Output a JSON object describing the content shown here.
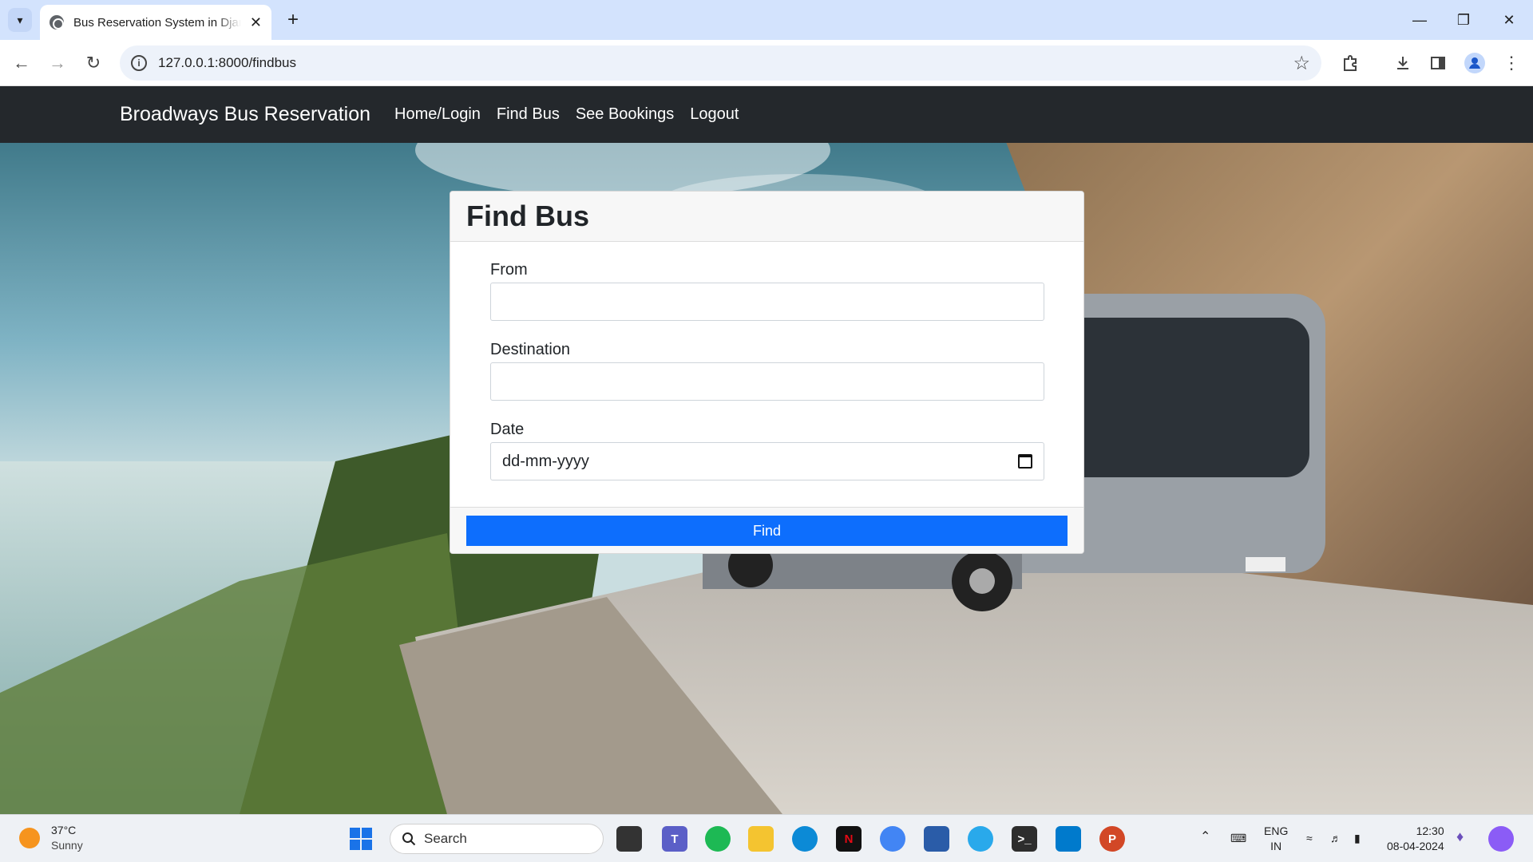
{
  "browser": {
    "tab_title": "Bus Reservation System in Django",
    "url": "127.0.0.1:8000/findbus"
  },
  "navbar": {
    "brand": "Broadways Bus Reservation",
    "links": [
      "Home/Login",
      "Find Bus",
      "See Bookings",
      "Logout"
    ]
  },
  "form": {
    "title": "Find Bus",
    "from_label": "From",
    "destination_label": "Destination",
    "date_label": "Date",
    "date_placeholder": "dd-mm-yyyy",
    "submit_label": "Find"
  },
  "taskbar": {
    "weather_temp": "37°C",
    "weather_condition": "Sunny",
    "search_label": "Search",
    "language": "ENG",
    "region": "IN",
    "time": "12:30",
    "date": "08-04-2024"
  },
  "colors": {
    "navbar": "#24282c",
    "primary_button": "#0d6efd",
    "tabstrip": "#d3e3fd"
  }
}
